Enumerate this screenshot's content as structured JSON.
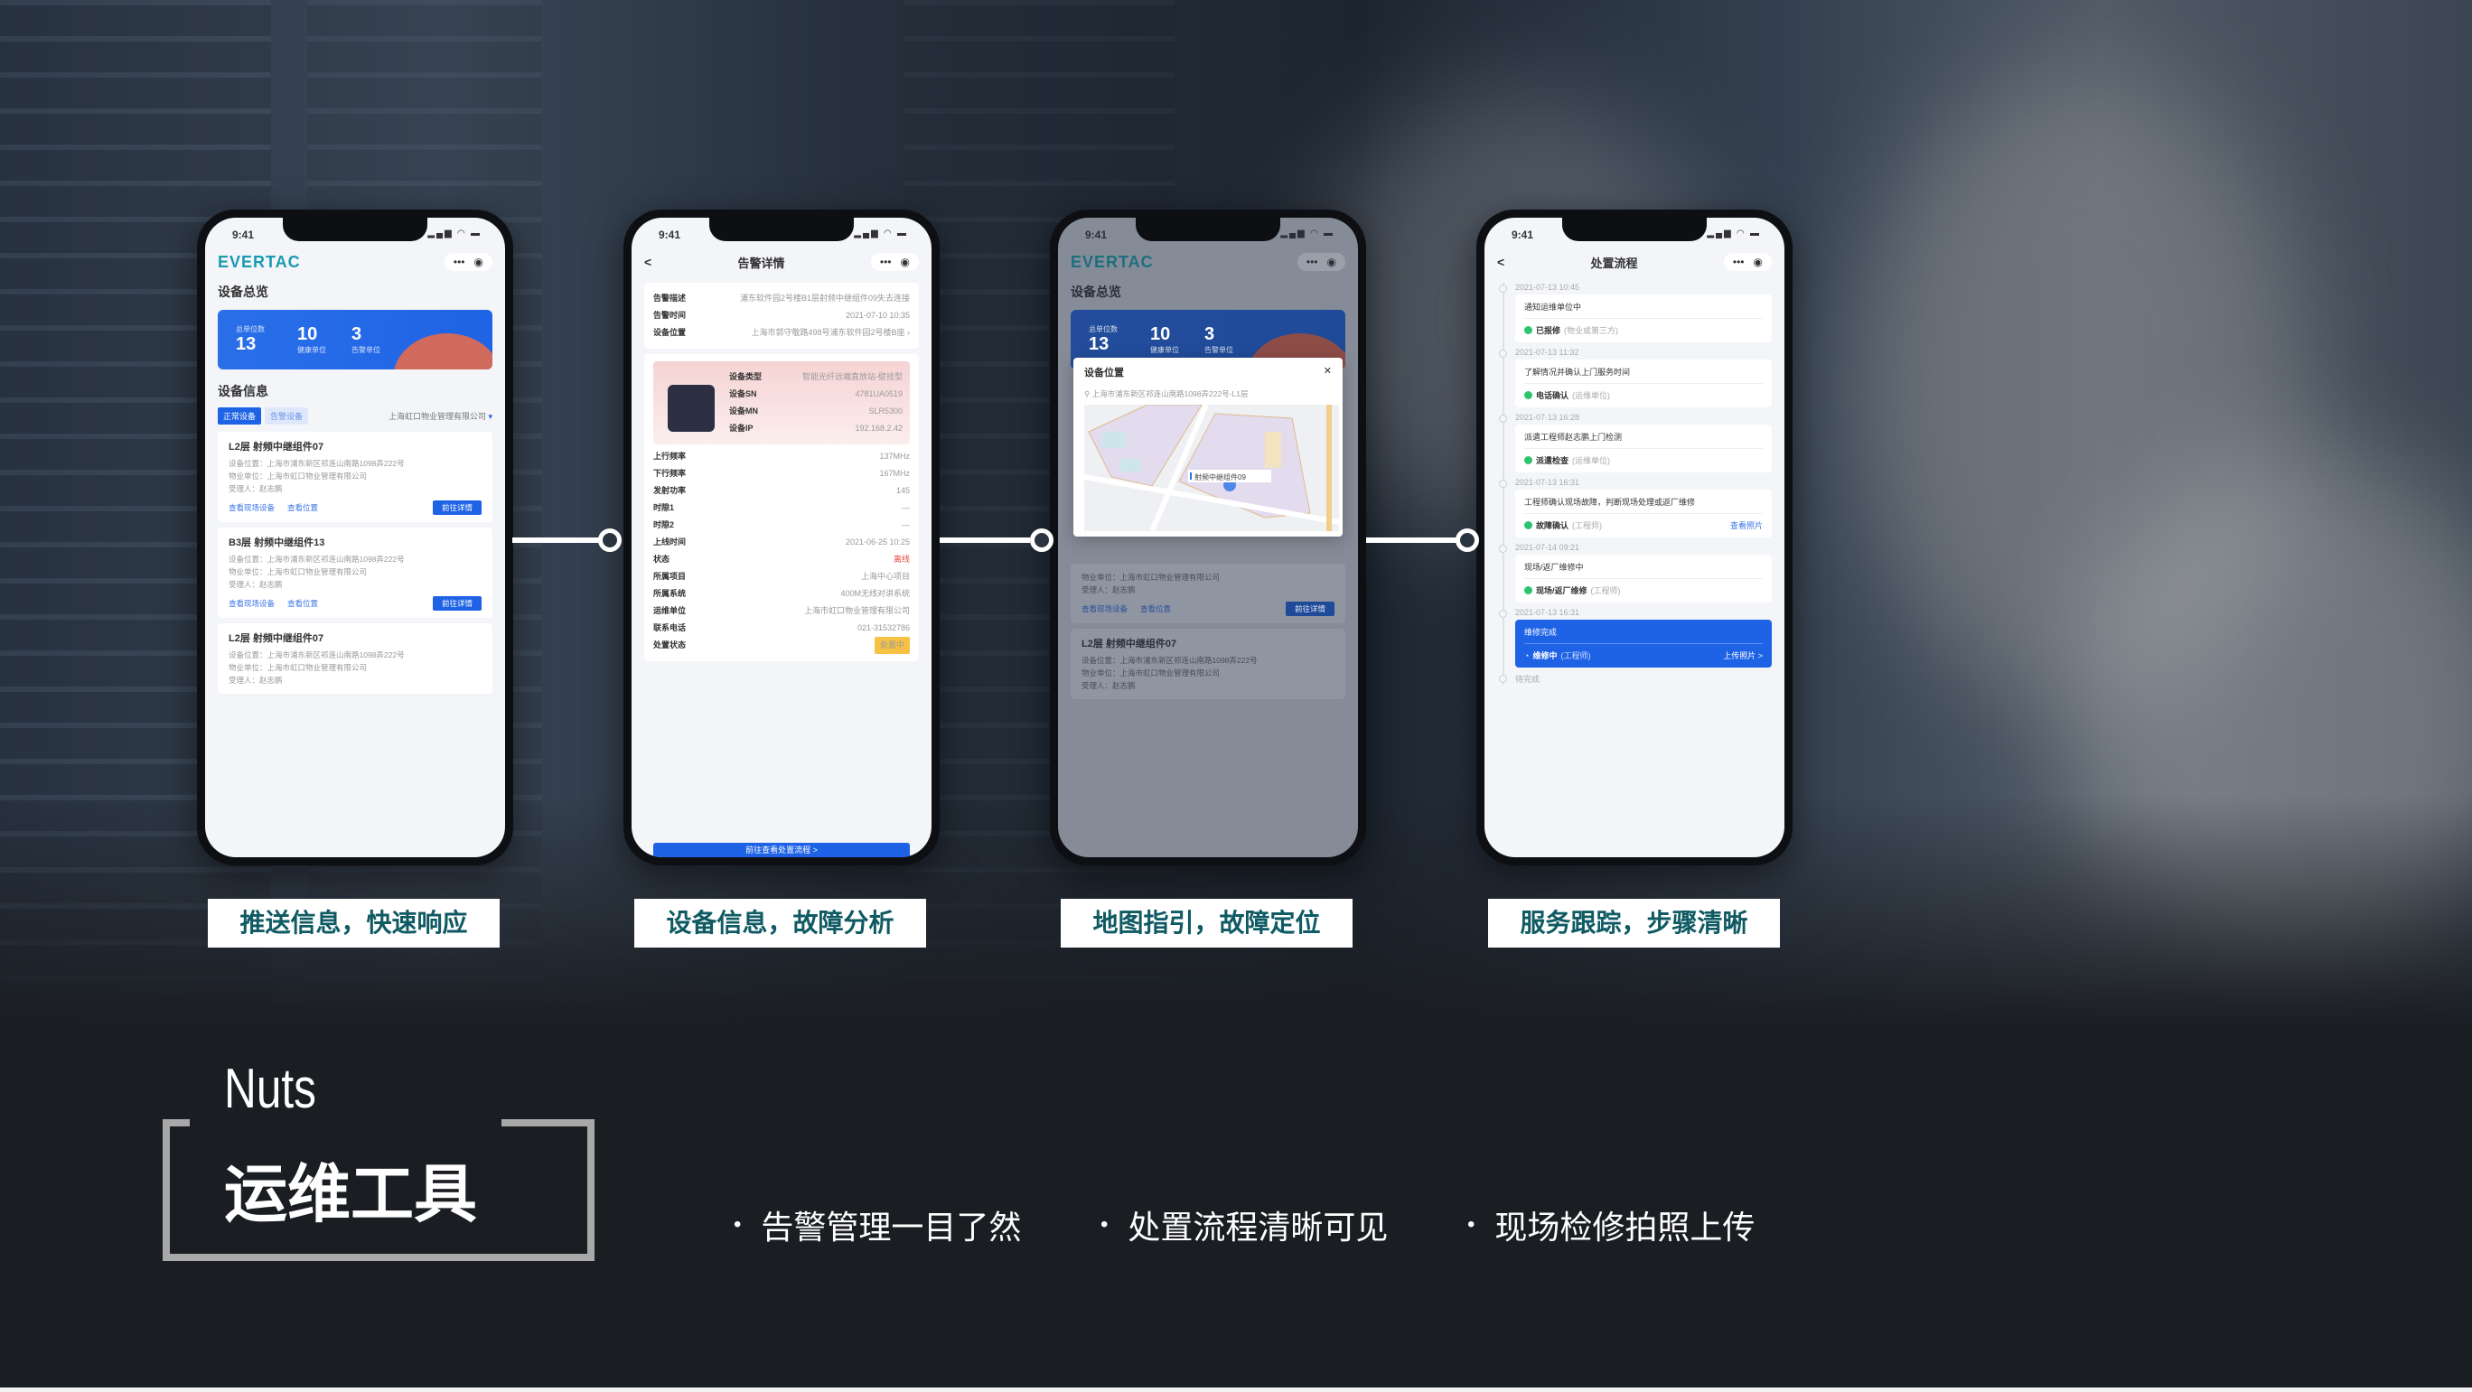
{
  "colors": {
    "accent": "#1e62e6",
    "caption_text": "#0f5a63",
    "alert": "#e26a4e",
    "bg_dark": "#1a1d22"
  },
  "phones": [
    {
      "time": "9:41",
      "logo": "EVERTAC",
      "capsule_more": "•••",
      "capsule_target": "◉",
      "overview_title": "设备总览",
      "stats": [
        {
          "value": "13",
          "label": "总单位数"
        },
        {
          "value": "10",
          "label": "健康单位"
        },
        {
          "value": "3",
          "label": "告警单位"
        }
      ],
      "info_title": "设备信息",
      "tabs": [
        "正常设备",
        "告警设备"
      ],
      "company": "上海虹口物业管理有限公司",
      "cards": [
        {
          "title": "L2层 射频中继组件07",
          "location": "设备位置：上海市浦东新区祁连山南路1098弄222号",
          "property": "物业单位：上海市虹口物业管理有限公司",
          "handler": "受理人：赵志鹏",
          "action1": "查看现场设备",
          "action2": "查看位置",
          "button": "前往详情"
        },
        {
          "title": "B3层 射频中继组件13",
          "location": "设备位置：上海市浦东新区祁连山南路1098弄222号",
          "property": "物业单位：上海市虹口物业管理有限公司",
          "handler": "受理人：赵志鹏",
          "action1": "查看现场设备",
          "action2": "查看位置",
          "button": "前往详情"
        },
        {
          "title": "L2层 射频中继组件07",
          "location": "设备位置：上海市浦东新区祁连山南路1098弄222号",
          "property": "物业单位：上海市虹口物业管理有限公司",
          "handler": "受理人：赵志鹏"
        }
      ]
    },
    {
      "time": "9:41",
      "back": "<",
      "title": "告警详情",
      "alarm_rows": [
        {
          "k": "告警描述",
          "v": "浦东软件园2号楼B1层射频中继组件09失去连接"
        },
        {
          "k": "告警时间",
          "v": "2021-07-10 10:35"
        },
        {
          "k": "设备位置",
          "v": "上海市郭守敬路498号浦东软件园2号楼B座 ›"
        }
      ],
      "device_rows": [
        {
          "k": "设备类型",
          "v": "智能光纤远端直放站-壁挂型"
        },
        {
          "k": "设备SN",
          "v": "4781UA0519"
        },
        {
          "k": "设备MN",
          "v": "SLR5300"
        },
        {
          "k": "设备IP",
          "v": "192.168.2.42"
        }
      ],
      "detail_rows": [
        {
          "k": "上行频率",
          "v": "137MHz"
        },
        {
          "k": "下行频率",
          "v": "167MHz"
        },
        {
          "k": "发射功率",
          "v": "145"
        },
        {
          "k": "时隙1",
          "v": "—"
        },
        {
          "k": "时隙2",
          "v": "—"
        },
        {
          "k": "上线时间",
          "v": "2021-06-25 10:25"
        },
        {
          "k": "状态",
          "v": "离线"
        },
        {
          "k": "所属项目",
          "v": "上海中心项目"
        },
        {
          "k": "所属系统",
          "v": "400M无线对讲系统"
        },
        {
          "k": "运维单位",
          "v": "上海市虹口物业管理有限公司"
        },
        {
          "k": "联系电话",
          "v": "021-31532786"
        },
        {
          "k": "处置状态",
          "v": "处置中"
        }
      ],
      "bottom_button": "前往查看处置流程 >"
    },
    {
      "time": "9:41",
      "logo": "EVERTAC",
      "overview_title": "设备总览",
      "stats": [
        {
          "value": "13",
          "label": "总单位数"
        },
        {
          "value": "10",
          "label": "健康单位"
        },
        {
          "value": "3",
          "label": "告警单位"
        }
      ],
      "modal_title": "设备位置",
      "close": "✕",
      "address": "上海市浦东新区祁连山南路1098弄222号-L1层",
      "marker_label": "射频中继组件09",
      "card_partial": {
        "property": "物业单位：上海市虹口物业管理有限公司",
        "handler": "受理人：赵志鹏",
        "action1": "查看现场设备",
        "action2": "查看位置",
        "button": "前往详情"
      },
      "card2": {
        "title": "L2层 射频中继组件07",
        "location": "设备位置：上海市浦东新区祁连山南路1098弄222号",
        "property": "物业单位：上海市虹口物业管理有限公司",
        "handler": "受理人：赵志鹏"
      }
    },
    {
      "time": "9:41",
      "back": "<",
      "title": "处置流程",
      "steps": [
        {
          "time": "2021-07-13 10:45",
          "desc": "通知运维单位中",
          "status": "已报修",
          "role": "(物业或第三方)"
        },
        {
          "time": "2021-07-13 11:32",
          "desc": "了解情况并确认上门服务时间",
          "status": "电话确认",
          "role": "(运维单位)"
        },
        {
          "time": "2021-07-13 16:28",
          "desc": "派遣工程师赵志鹏上门检测",
          "status": "派遣检查",
          "role": "(运维单位)"
        },
        {
          "time": "2021-07-13 16:31",
          "desc": "工程师确认现场故障，判断现场处理或返厂维修",
          "status": "故障确认",
          "role": "(工程师)",
          "link": "查看照片"
        },
        {
          "time": "2021-07-14 09:21",
          "desc": "现场/返厂维修中",
          "status": "现场/返厂维修",
          "role": "(工程师)"
        }
      ],
      "active_step": {
        "time": "2021-07-13 16:31",
        "desc": "维修完成",
        "status": "维修中",
        "role": "(工程师)",
        "link": "上传照片 >"
      },
      "pending": "待完成"
    }
  ],
  "captions": [
    "推送信息，快速响应",
    "设备信息，故障分析",
    "地图指引，故障定位",
    "服务跟踪，步骤清晰"
  ],
  "brand": {
    "subtitle": "Nuts",
    "title": "运维工具"
  },
  "bullets": [
    "告警管理一目了然",
    "处置流程清晰可见",
    "现场检修拍照上传"
  ]
}
